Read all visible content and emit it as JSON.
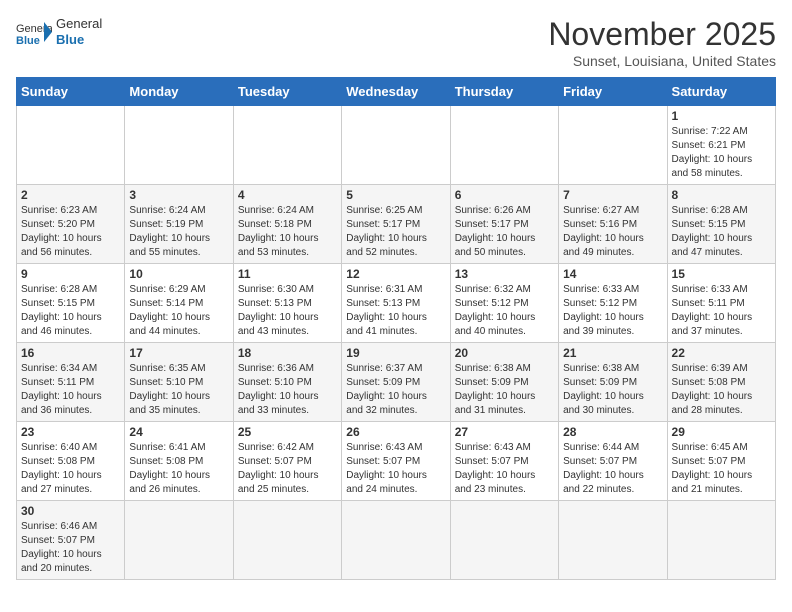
{
  "logo": {
    "general": "General",
    "blue": "Blue"
  },
  "title": "November 2025",
  "subtitle": "Sunset, Louisiana, United States",
  "days_of_week": [
    "Sunday",
    "Monday",
    "Tuesday",
    "Wednesday",
    "Thursday",
    "Friday",
    "Saturday"
  ],
  "weeks": [
    [
      {
        "day": "",
        "info": ""
      },
      {
        "day": "",
        "info": ""
      },
      {
        "day": "",
        "info": ""
      },
      {
        "day": "",
        "info": ""
      },
      {
        "day": "",
        "info": ""
      },
      {
        "day": "",
        "info": ""
      },
      {
        "day": "1",
        "info": "Sunrise: 7:22 AM\nSunset: 6:21 PM\nDaylight: 10 hours and 58 minutes."
      }
    ],
    [
      {
        "day": "2",
        "info": "Sunrise: 6:23 AM\nSunset: 5:20 PM\nDaylight: 10 hours and 56 minutes."
      },
      {
        "day": "3",
        "info": "Sunrise: 6:24 AM\nSunset: 5:19 PM\nDaylight: 10 hours and 55 minutes."
      },
      {
        "day": "4",
        "info": "Sunrise: 6:24 AM\nSunset: 5:18 PM\nDaylight: 10 hours and 53 minutes."
      },
      {
        "day": "5",
        "info": "Sunrise: 6:25 AM\nSunset: 5:17 PM\nDaylight: 10 hours and 52 minutes."
      },
      {
        "day": "6",
        "info": "Sunrise: 6:26 AM\nSunset: 5:17 PM\nDaylight: 10 hours and 50 minutes."
      },
      {
        "day": "7",
        "info": "Sunrise: 6:27 AM\nSunset: 5:16 PM\nDaylight: 10 hours and 49 minutes."
      },
      {
        "day": "8",
        "info": "Sunrise: 6:28 AM\nSunset: 5:15 PM\nDaylight: 10 hours and 47 minutes."
      }
    ],
    [
      {
        "day": "9",
        "info": "Sunrise: 6:28 AM\nSunset: 5:15 PM\nDaylight: 10 hours and 46 minutes."
      },
      {
        "day": "10",
        "info": "Sunrise: 6:29 AM\nSunset: 5:14 PM\nDaylight: 10 hours and 44 minutes."
      },
      {
        "day": "11",
        "info": "Sunrise: 6:30 AM\nSunset: 5:13 PM\nDaylight: 10 hours and 43 minutes."
      },
      {
        "day": "12",
        "info": "Sunrise: 6:31 AM\nSunset: 5:13 PM\nDaylight: 10 hours and 41 minutes."
      },
      {
        "day": "13",
        "info": "Sunrise: 6:32 AM\nSunset: 5:12 PM\nDaylight: 10 hours and 40 minutes."
      },
      {
        "day": "14",
        "info": "Sunrise: 6:33 AM\nSunset: 5:12 PM\nDaylight: 10 hours and 39 minutes."
      },
      {
        "day": "15",
        "info": "Sunrise: 6:33 AM\nSunset: 5:11 PM\nDaylight: 10 hours and 37 minutes."
      }
    ],
    [
      {
        "day": "16",
        "info": "Sunrise: 6:34 AM\nSunset: 5:11 PM\nDaylight: 10 hours and 36 minutes."
      },
      {
        "day": "17",
        "info": "Sunrise: 6:35 AM\nSunset: 5:10 PM\nDaylight: 10 hours and 35 minutes."
      },
      {
        "day": "18",
        "info": "Sunrise: 6:36 AM\nSunset: 5:10 PM\nDaylight: 10 hours and 33 minutes."
      },
      {
        "day": "19",
        "info": "Sunrise: 6:37 AM\nSunset: 5:09 PM\nDaylight: 10 hours and 32 minutes."
      },
      {
        "day": "20",
        "info": "Sunrise: 6:38 AM\nSunset: 5:09 PM\nDaylight: 10 hours and 31 minutes."
      },
      {
        "day": "21",
        "info": "Sunrise: 6:38 AM\nSunset: 5:09 PM\nDaylight: 10 hours and 30 minutes."
      },
      {
        "day": "22",
        "info": "Sunrise: 6:39 AM\nSunset: 5:08 PM\nDaylight: 10 hours and 28 minutes."
      }
    ],
    [
      {
        "day": "23",
        "info": "Sunrise: 6:40 AM\nSunset: 5:08 PM\nDaylight: 10 hours and 27 minutes."
      },
      {
        "day": "24",
        "info": "Sunrise: 6:41 AM\nSunset: 5:08 PM\nDaylight: 10 hours and 26 minutes."
      },
      {
        "day": "25",
        "info": "Sunrise: 6:42 AM\nSunset: 5:07 PM\nDaylight: 10 hours and 25 minutes."
      },
      {
        "day": "26",
        "info": "Sunrise: 6:43 AM\nSunset: 5:07 PM\nDaylight: 10 hours and 24 minutes."
      },
      {
        "day": "27",
        "info": "Sunrise: 6:43 AM\nSunset: 5:07 PM\nDaylight: 10 hours and 23 minutes."
      },
      {
        "day": "28",
        "info": "Sunrise: 6:44 AM\nSunset: 5:07 PM\nDaylight: 10 hours and 22 minutes."
      },
      {
        "day": "29",
        "info": "Sunrise: 6:45 AM\nSunset: 5:07 PM\nDaylight: 10 hours and 21 minutes."
      }
    ],
    [
      {
        "day": "30",
        "info": "Sunrise: 6:46 AM\nSunset: 5:07 PM\nDaylight: 10 hours and 20 minutes."
      },
      {
        "day": "",
        "info": ""
      },
      {
        "day": "",
        "info": ""
      },
      {
        "day": "",
        "info": ""
      },
      {
        "day": "",
        "info": ""
      },
      {
        "day": "",
        "info": ""
      },
      {
        "day": "",
        "info": ""
      }
    ]
  ],
  "row_styles": [
    "row-white",
    "row-gray",
    "row-white",
    "row-gray",
    "row-white",
    "row-gray"
  ]
}
